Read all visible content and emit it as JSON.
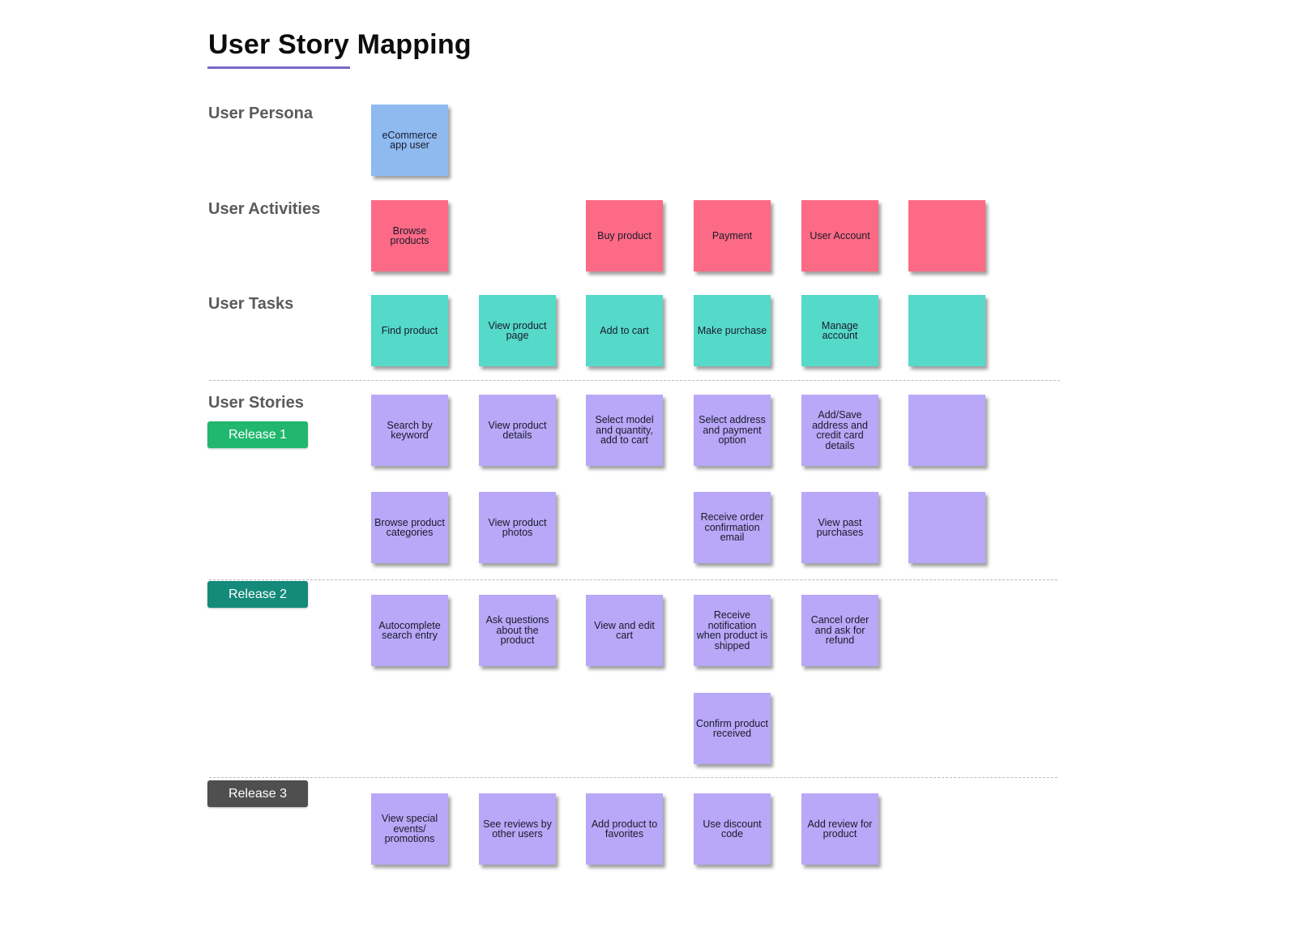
{
  "title": "User Story Mapping",
  "colors": {
    "title_underline": "#7b68c8",
    "persona": "#8fbaf0",
    "activity": "#fd6a85",
    "task": "#55d9c9",
    "story": "#b8a8f7",
    "release_1": "#21b76e",
    "release_2": "#148a7a",
    "release_3": "#4f4f4f"
  },
  "sections": {
    "persona": "User Persona",
    "activities": "User Activities",
    "tasks": "User Tasks",
    "stories": "User Stories"
  },
  "releases": [
    {
      "label": "Release 1"
    },
    {
      "label": "Release 2"
    },
    {
      "label": "Release 3"
    }
  ],
  "persona": [
    {
      "col": 0,
      "text": "eCommerce app user"
    }
  ],
  "activities": [
    {
      "col": 0,
      "text": "Browse products"
    },
    {
      "col": 2,
      "text": "Buy product"
    },
    {
      "col": 3,
      "text": "Payment"
    },
    {
      "col": 4,
      "text": "User Account"
    },
    {
      "col": 5,
      "text": ""
    }
  ],
  "tasks": [
    {
      "col": 0,
      "text": "Find product"
    },
    {
      "col": 1,
      "text": "View product page"
    },
    {
      "col": 2,
      "text": "Add to cart"
    },
    {
      "col": 3,
      "text": "Make purchase"
    },
    {
      "col": 4,
      "text": "Manage account"
    },
    {
      "col": 5,
      "text": ""
    }
  ],
  "stories": {
    "release_1": [
      [
        {
          "col": 0,
          "text": "Search by keyword"
        },
        {
          "col": 1,
          "text": "View product details"
        },
        {
          "col": 2,
          "text": "Select model and quantity, add to cart"
        },
        {
          "col": 3,
          "text": "Select address and payment option"
        },
        {
          "col": 4,
          "text": "Add/Save address and credit card details"
        },
        {
          "col": 5,
          "text": ""
        }
      ],
      [
        {
          "col": 0,
          "text": "Browse product categories"
        },
        {
          "col": 1,
          "text": "View product photos"
        },
        {
          "col": 3,
          "text": "Receive order confirmation email"
        },
        {
          "col": 4,
          "text": "View past purchases"
        },
        {
          "col": 5,
          "text": ""
        }
      ]
    ],
    "release_2": [
      [
        {
          "col": 0,
          "text": "Autocomplete search entry"
        },
        {
          "col": 1,
          "text": "Ask questions about the product"
        },
        {
          "col": 2,
          "text": "View and edit cart"
        },
        {
          "col": 3,
          "text": "Receive notification when product is shipped"
        },
        {
          "col": 4,
          "text": "Cancel order and ask for refund"
        }
      ],
      [
        {
          "col": 3,
          "text": "Confirm product received"
        }
      ]
    ],
    "release_3": [
      [
        {
          "col": 0,
          "text": "View special events/ promotions"
        },
        {
          "col": 1,
          "text": "See reviews by other users"
        },
        {
          "col": 2,
          "text": "Add product to favorites"
        },
        {
          "col": 3,
          "text": "Use discount code"
        },
        {
          "col": 4,
          "text": "Add review for product"
        }
      ]
    ]
  }
}
